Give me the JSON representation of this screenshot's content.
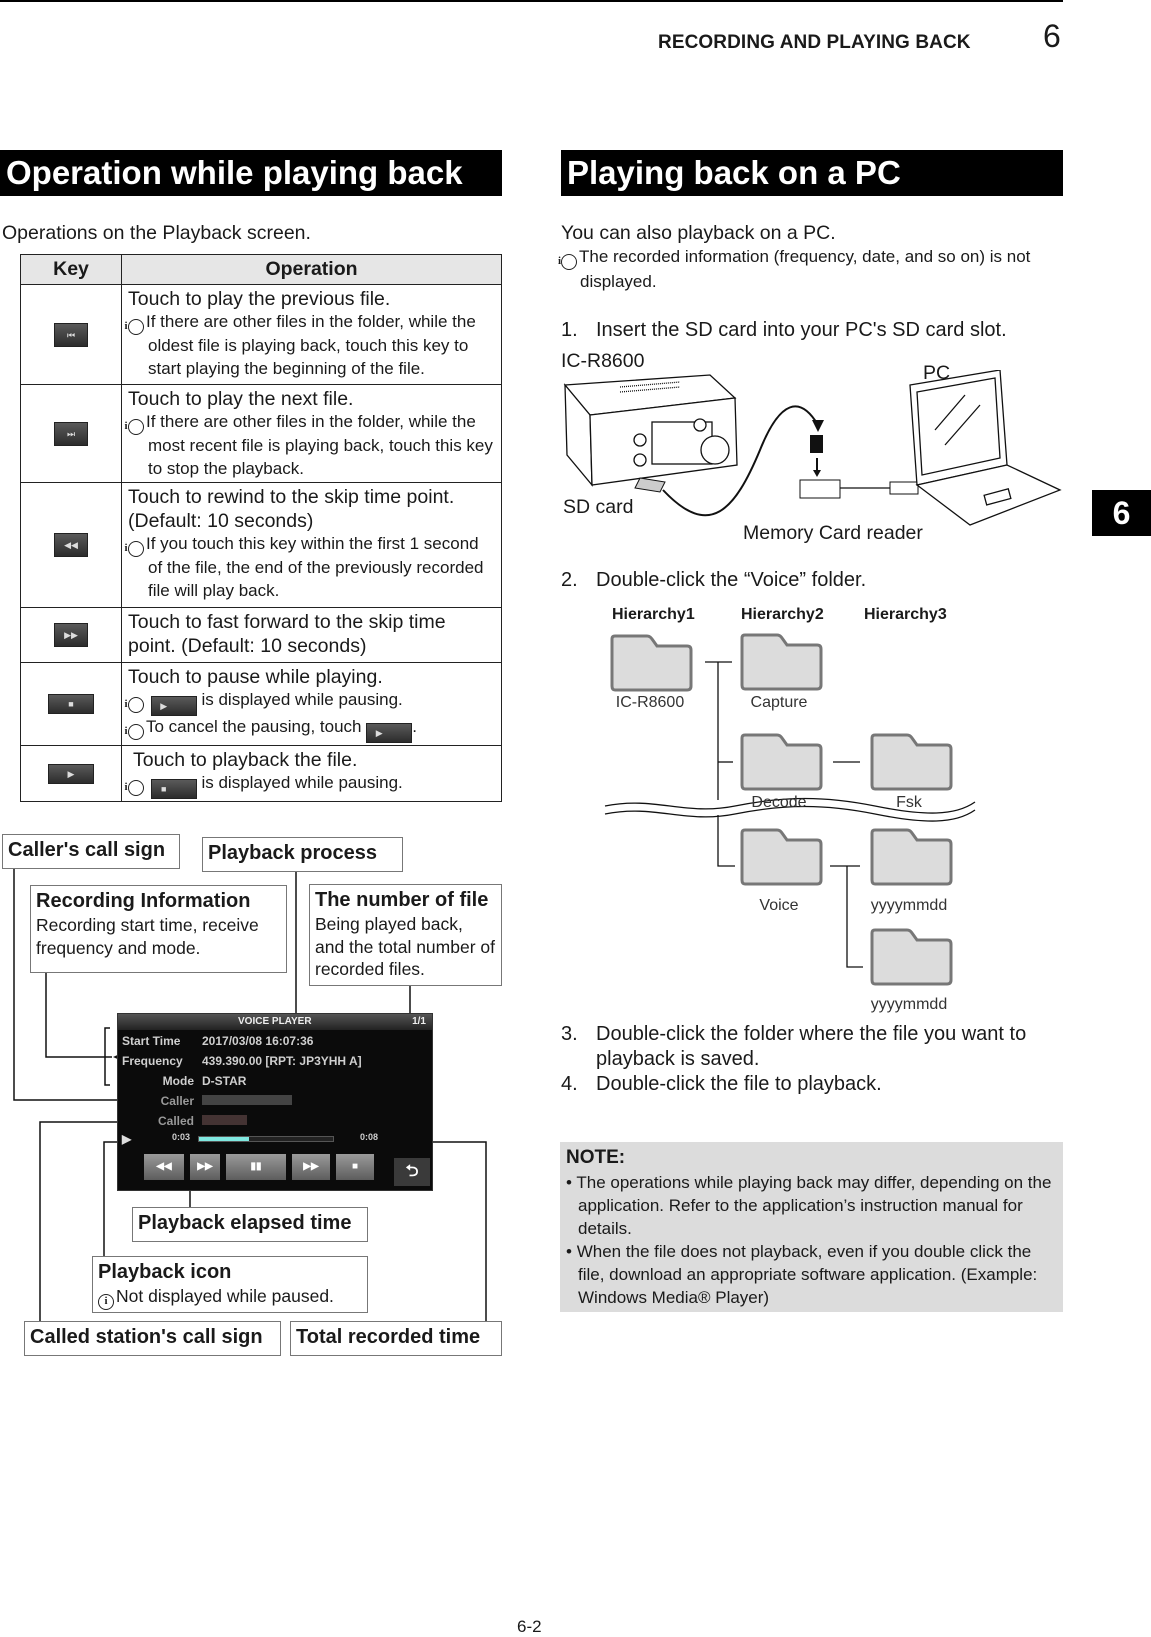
{
  "header": {
    "running_title": "RECORDING AND PLAYING BACK",
    "chapter_number": "6"
  },
  "side_tab": "6",
  "footer": {
    "page_number": "6-2"
  },
  "left": {
    "section_title": "Operation while playing back",
    "intro": "Operations on the Playback screen.",
    "table": {
      "headers": [
        "Key",
        "Operation"
      ],
      "rows": [
        {
          "key_icon": "previous-file-icon",
          "key_glyph": "⏮",
          "main": "Touch to play the previous file.",
          "notes": [
            "If there are other files in the folder, while the oldest file is playing back, touch this key to start playing the beginning of the file."
          ]
        },
        {
          "key_icon": "next-file-icon",
          "key_glyph": "⏭",
          "main": "Touch to play the next file.",
          "notes": [
            "If there are other files in the folder, while the most recent file is playing back, touch this key to stop the playback."
          ]
        },
        {
          "key_icon": "rewind-icon",
          "key_glyph": "◀◀",
          "main": "Touch to rewind to the skip time point. (Default: 10 seconds)",
          "notes": [
            "If you touch this key within the first 1 second of the file, the end of the previously recorded file will play back."
          ]
        },
        {
          "key_icon": "fast-forward-icon",
          "key_glyph": "▶▶",
          "main": "Touch to fast forward to the skip time point. (Default: 10 seconds)",
          "notes": []
        },
        {
          "key_icon": "pause-icon",
          "key_glyph": "■",
          "main": "Touch to pause while playing.",
          "note_a_suffix": "is displayed while pausing.",
          "note_b_prefix": "To cancel the pausing, touch",
          "note_b_suffix": "."
        },
        {
          "key_icon": "play-icon",
          "key_glyph": "▶",
          "main": "Touch to playback the file.",
          "note_a_suffix": "is displayed while pausing."
        }
      ]
    },
    "diagram": {
      "callouts": {
        "callers_call_sign": "Caller's call sign",
        "playback_process": "Playback process",
        "recording_info_title": "Recording Information",
        "recording_info_desc": "Recording start time, receive frequency and mode.",
        "file_number_title": "The number of file",
        "file_number_desc": "Being played back, and the total number of recorded files.",
        "elapsed_time": "Playback elapsed time",
        "playback_icon_title": "Playback icon",
        "playback_icon_desc": "Not displayed while paused.",
        "called_call_sign": "Called station's call sign",
        "total_time": "Total recorded time"
      },
      "screen": {
        "title": "VOICE PLAYER",
        "file_count": "1/1",
        "start_time_label": "Start Time",
        "start_time_value": "2017/03/08  16:07:36",
        "frequency_label": "Frequency",
        "frequency_value": "439.390.00  [RPT: JP3YHH A]",
        "mode_label": "Mode",
        "mode_value": "D-STAR",
        "caller_label": "Caller",
        "called_label": "Called",
        "elapsed": "0:03",
        "total": "0:08",
        "progress_fraction": 0.375
      }
    }
  },
  "right": {
    "section_title": "Playing back on a PC",
    "intro": "You can also playback on a PC.",
    "intro_note": "The recorded information (frequency, date, and so on) is not displayed.",
    "steps": [
      {
        "num": "1.",
        "text": "Insert the SD card into your PC's SD card slot."
      },
      {
        "num": "2.",
        "text": "Double-click the “Voice” folder."
      },
      {
        "num": "3.",
        "text": "Double-click the folder where the file you want to playback is saved."
      },
      {
        "num": "4.",
        "text": "Double-click the file to playback."
      }
    ],
    "connection_diagram": {
      "radio": "IC-R8600",
      "pc": "PC",
      "sd_card": "SD card",
      "reader": "Memory Card reader"
    },
    "folders": {
      "hierarchy_labels": [
        "Hierarchy1",
        "Hierarchy2",
        "Hierarchy3"
      ],
      "items": [
        "IC-R8600",
        "Capture",
        "Decode",
        "Fsk",
        "Voice",
        "yyyymmdd",
        "yyyymmdd"
      ]
    },
    "note": {
      "title": "NOTE:",
      "bullets": [
        "The operations while playing back may differ, depending on the application. Refer to the application’s instruction manual for details.",
        "When the file does not playback, even if you double click the file, download an appropriate software application. (Example: Windows Media® Player)"
      ]
    }
  }
}
